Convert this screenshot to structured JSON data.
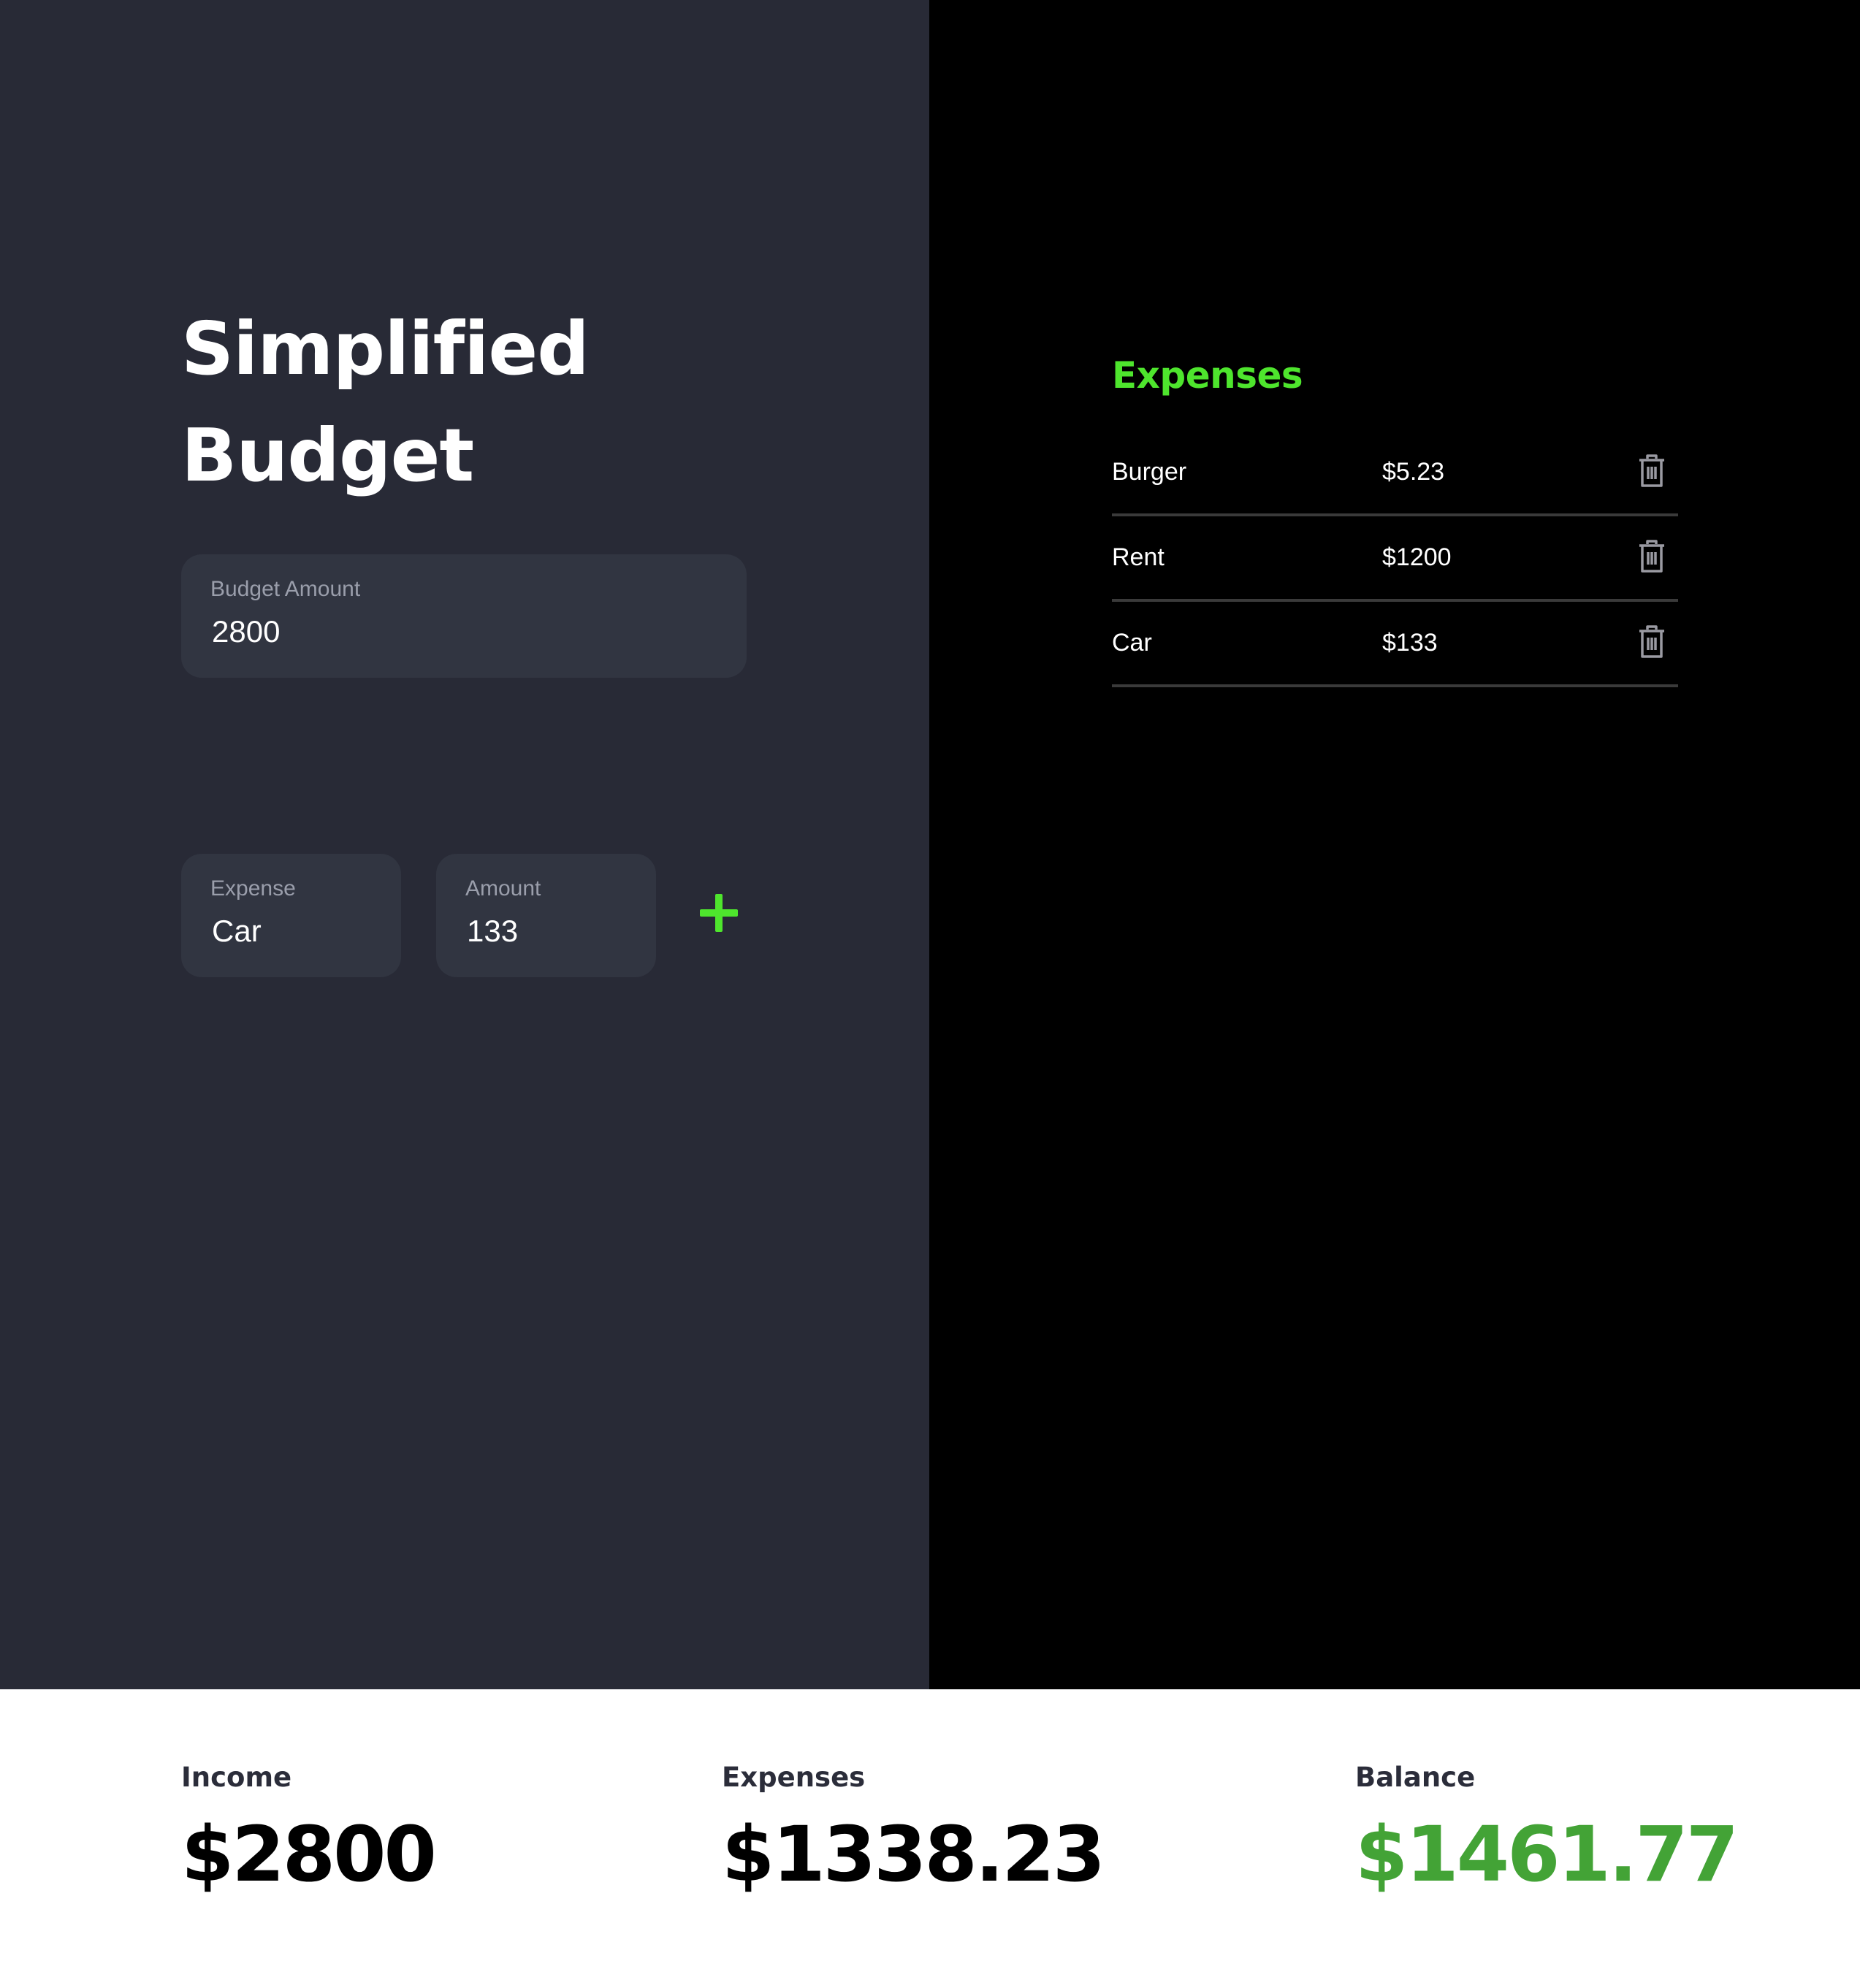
{
  "app": {
    "title_line1": "Simplified",
    "title_line2": "Budget"
  },
  "budget": {
    "label": "Budget Amount",
    "value": "2800"
  },
  "new_expense": {
    "expense_label": "Expense",
    "expense_value": "Car",
    "amount_label": "Amount",
    "amount_value": "133",
    "add_icon": "plus-icon"
  },
  "expenses": {
    "heading": "Expenses",
    "items": [
      {
        "name": "Burger",
        "amount": "$5.23",
        "icon": "trash-icon"
      },
      {
        "name": "Rent",
        "amount": "$1200",
        "icon": "trash-icon"
      },
      {
        "name": "Car",
        "amount": "$133",
        "icon": "trash-icon"
      }
    ]
  },
  "summary": {
    "income_label": "Income",
    "income_value": "$2800",
    "expenses_label": "Expenses",
    "expenses_value": "$1338.23",
    "balance_label": "Balance",
    "balance_value": "$1461.77"
  },
  "colors": {
    "left_bg": "#282a36",
    "right_bg": "#000000",
    "field_bg": "#313541",
    "accent_green": "#4ee52d",
    "balance_green": "#43a336",
    "summary_bg": "#ffffff"
  }
}
